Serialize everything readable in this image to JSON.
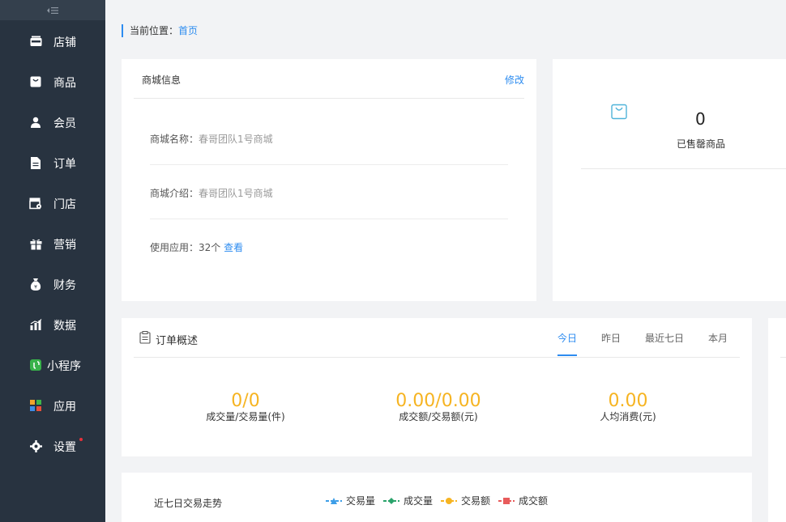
{
  "sidebar": {
    "collapse_glyph": "⇤☰",
    "items": [
      {
        "label": "店铺",
        "icon": "store-icon"
      },
      {
        "label": "商品",
        "icon": "bag-icon"
      },
      {
        "label": "会员",
        "icon": "user-icon"
      },
      {
        "label": "订单",
        "icon": "document-icon"
      },
      {
        "label": "门店",
        "icon": "shop-settings-icon"
      },
      {
        "label": "营销",
        "icon": "gift-icon"
      },
      {
        "label": "财务",
        "icon": "money-bag-icon"
      },
      {
        "label": "数据",
        "icon": "bar-chart-icon"
      },
      {
        "label": "小程序",
        "icon": "mini-program-icon"
      },
      {
        "label": "应用",
        "icon": "apps-icon"
      },
      {
        "label": "设置",
        "icon": "gear-icon"
      }
    ]
  },
  "breadcrumb": {
    "prefix": "当前位置：",
    "current": "首页"
  },
  "shop_info": {
    "title": "商城信息",
    "edit_label": "修改",
    "name_key": "商城名称：",
    "name_value": "春哥团队1号商城",
    "intro_key": "商城介绍：",
    "intro_value": "春哥团队1号商城",
    "apps_key": "使用应用：",
    "apps_value": "32个",
    "apps_link": "查看"
  },
  "sold_out": {
    "count": "0",
    "label": "已售罄商品"
  },
  "order_overview": {
    "title": "订单概述",
    "tabs": [
      "今日",
      "昨日",
      "最近七日",
      "本月"
    ],
    "active_tab": 0,
    "metrics": [
      {
        "value": "0/0",
        "label": "成交量/交易量(件)"
      },
      {
        "value": "0.00/0.00",
        "label": "成交额/交易额(元)"
      },
      {
        "value": "0.00",
        "label": "人均消费(元)"
      }
    ]
  },
  "trend": {
    "title": "近七日交易走势",
    "legend": [
      {
        "label": "交易量",
        "color": "#3d9ee8",
        "shape": "triangle"
      },
      {
        "label": "成交量",
        "color": "#2aa36b",
        "shape": "diamond"
      },
      {
        "label": "交易额",
        "color": "#f6b422",
        "shape": "circle"
      },
      {
        "label": "成交额",
        "color": "#e85b5b",
        "shape": "square"
      }
    ]
  },
  "colors": {
    "accent": "#2d8cf0",
    "metric": "#f6b422",
    "sidebar": "#283340",
    "badge": "#e8303a"
  }
}
